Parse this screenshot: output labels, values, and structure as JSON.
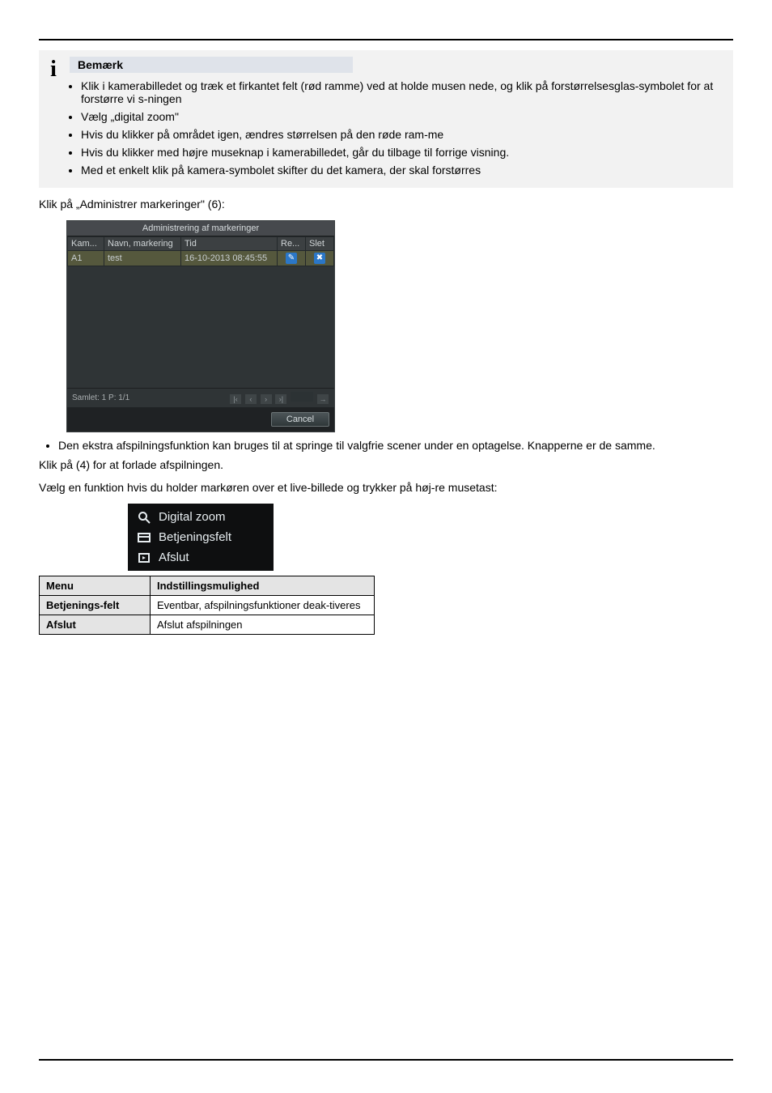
{
  "bemaerk": {
    "heading": "Bemærk",
    "items": [
      "Klik i kamerabilledet og træk et firkantet felt (rød ramme) ved at holde musen nede, og klik på forstørrelsesglas-symbolet for at forstørre vi s-ningen",
      "Vælg „digital zoom\"",
      "Hvis du klikker på området igen, ændres størrelsen på den røde ram-me",
      "Hvis du klikker med højre museknap i kamerabilledet, går du tilbage til forrige visning.",
      "Med et enkelt klik på kamera-symbolet skifter du det kamera, der skal forstørres"
    ]
  },
  "para1": "Klik på „Administrer markeringer\" (6):",
  "dialog": {
    "title": "Administrering af markeringer",
    "cols": {
      "c1": "Kam...",
      "c2": "Navn, markering",
      "c3": "Tid",
      "c4": "Re...",
      "c5": "Slet"
    },
    "row": {
      "cam": "A1",
      "name": "test",
      "time": "16-10-2013 08:45:55"
    },
    "status": "Samlet: 1 P: 1/1",
    "go_symbol": "→",
    "cancel": "Cancel"
  },
  "afterDialog": {
    "bullet": "Den ekstra afspilningsfunktion kan bruges til at springe til valgfrie scener under en optagelse. Knapperne er de samme.",
    "extra": "Klik på (4) for at forlade afspilningen."
  },
  "ctxLead": "Vælg en funktion hvis du holder markøren over et live-billede og trykker på høj-re musetast:",
  "ctx": {
    "items": [
      {
        "icon": "zoom",
        "label": "Digital zoom"
      },
      {
        "icon": "panel",
        "label": "Betjeningsfelt"
      },
      {
        "icon": "exit",
        "label": "Afslut"
      }
    ]
  },
  "desc": {
    "h1": "Menu",
    "h2": "Indstillingsmulighed",
    "rows": [
      {
        "k": "Betjenings-felt",
        "v": "Eventbar, afspilningsfunktioner deak-tiveres"
      },
      {
        "k": "Afslut",
        "v": "Afslut afspilningen"
      }
    ]
  }
}
